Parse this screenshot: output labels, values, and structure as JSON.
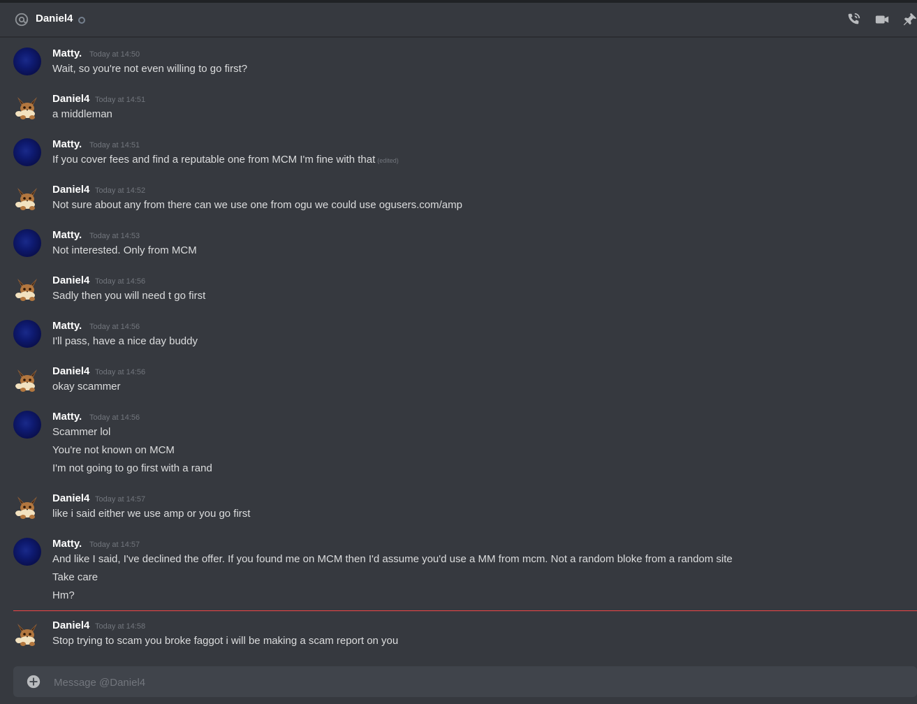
{
  "header": {
    "title": "Daniel4",
    "icons": [
      "at-icon",
      "phone-call-icon",
      "video-icon",
      "pin-icon"
    ]
  },
  "messages": [
    {
      "author": "Matty.",
      "time": "Today at 14:50",
      "lines": [
        "Wait, so you're not even willing to go first?"
      ]
    },
    {
      "author": "Daniel4",
      "time": "Today at 14:51",
      "lines": [
        "a middleman"
      ]
    },
    {
      "author": "Matty.",
      "time": "Today at 14:51",
      "lines": [
        "If you cover fees and find a reputable one from MCM I'm fine with that"
      ],
      "edited": "(edited)"
    },
    {
      "author": "Daniel4",
      "time": "Today at 14:52",
      "lines": [
        "Not sure about any from there can we use one from ogu we could use ogusers.com/amp"
      ]
    },
    {
      "author": "Matty.",
      "time": "Today at 14:53",
      "lines": [
        "Not interested. Only from MCM"
      ]
    },
    {
      "author": "Daniel4",
      "time": "Today at 14:56",
      "lines": [
        "Sadly then you will need t go first"
      ]
    },
    {
      "author": "Matty.",
      "time": "Today at 14:56",
      "lines": [
        "I'll pass, have a nice day buddy"
      ]
    },
    {
      "author": "Daniel4",
      "time": "Today at 14:56",
      "lines": [
        "okay scammer"
      ]
    },
    {
      "author": "Matty.",
      "time": "Today at 14:56",
      "lines": [
        "Scammer lol",
        "You're not known on MCM",
        "I'm not going to go first with a rand"
      ]
    },
    {
      "author": "Daniel4",
      "time": "Today at 14:57",
      "lines": [
        "like i said either we use amp or you go first"
      ]
    },
    {
      "author": "Matty.",
      "time": "Today at 14:57",
      "lines": [
        "And like I said, I've declined the offer. If you found me on MCM then I'd assume you'd use a MM from mcm. Not a random bloke from a random site",
        "Take care",
        "Hm?"
      ]
    },
    {
      "author": "Daniel4",
      "time": "Today at 14:58",
      "lines": [
        "Stop trying to scam you broke faggot i will be making a scam report on you"
      ]
    }
  ],
  "composer": {
    "placeholder": "Message @Daniel4"
  },
  "colors": {
    "background": "#36393f",
    "new_messages_divider": "#f04747",
    "composer_bg": "#40444b"
  }
}
